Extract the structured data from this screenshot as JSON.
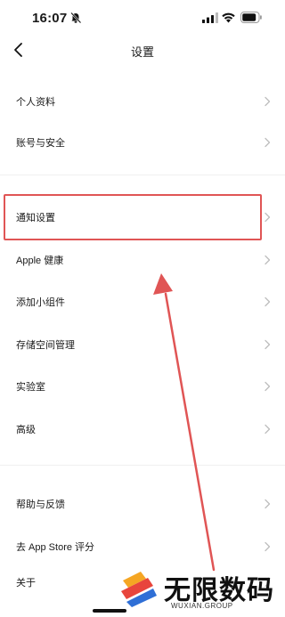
{
  "status": {
    "time": "16:07"
  },
  "nav": {
    "title": "设置"
  },
  "settings": {
    "group1": [
      {
        "label": "个人资料"
      },
      {
        "label": "账号与安全"
      }
    ],
    "group2": [
      {
        "label": "通知设置"
      },
      {
        "label": "Apple 健康"
      },
      {
        "label": "添加小组件"
      },
      {
        "label": "存储空间管理"
      },
      {
        "label": "实验室"
      },
      {
        "label": "高级"
      }
    ],
    "group3": [
      {
        "label": "帮助与反馈"
      },
      {
        "label": "去 App Store 评分"
      },
      {
        "label": "关于"
      }
    ]
  },
  "annotation": {
    "highlighted_item": "通知设置",
    "color": "#e05555"
  },
  "watermark": {
    "title": "无限数码",
    "url": "WUXIAN.GROUP"
  }
}
